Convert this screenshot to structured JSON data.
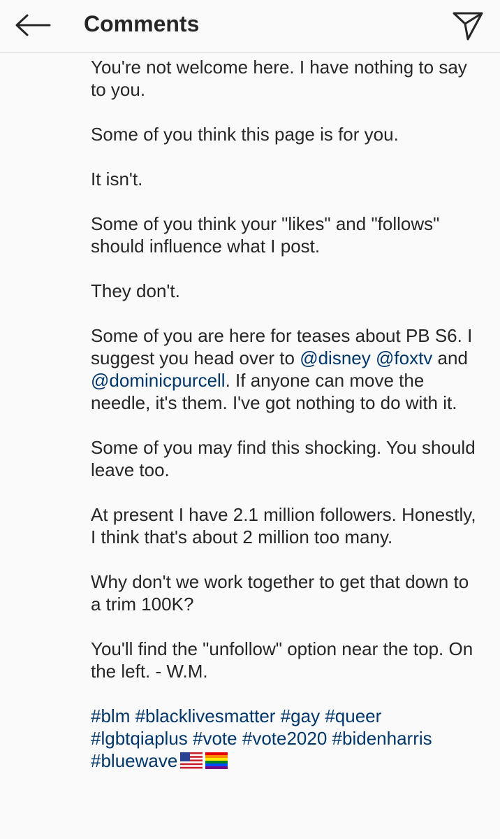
{
  "header": {
    "title": "Comments",
    "back_icon": "arrow-left-icon",
    "share_icon": "paper-plane-icon"
  },
  "caption": {
    "p1": "You're not welcome here. I have nothing to say to you.",
    "p2": "Some of you think this page is for you.",
    "p3": "It isn't.",
    "p4": "Some of you think your \"likes\" and \"follows\" should influence what I post.",
    "p5": "They don't.",
    "p6": {
      "t1": "Some of you are here for teases about PB S6. I suggest you head over to ",
      "m1": "@disney",
      "m2": "@foxtv",
      "t2": " and ",
      "m3": "@dominicpurcell",
      "t3": ". If anyone can move the needle, it's them. I've got nothing to do with it."
    },
    "p7": "Some of you may find this shocking. You should leave too.",
    "p8": "At present I have 2.1 million followers. Honestly, I think that's about 2 million too many.",
    "p9": "Why don't we work together to get that down to a trim 100K?",
    "p10": "You'll find the \"unfollow\" option near the top. On the left. - W.M.",
    "hashtags": [
      "#blm",
      "#blacklivesmatter",
      "#gay",
      "#queer",
      "#lgbtqiaplus",
      "#vote",
      "#vote2020",
      "#bidenharris",
      "#bluewave"
    ],
    "emoji": [
      "us-flag-emoji",
      "rainbow-flag-emoji"
    ]
  },
  "colors": {
    "link": "#00376b",
    "text": "#262626",
    "background": "#fafafa"
  }
}
